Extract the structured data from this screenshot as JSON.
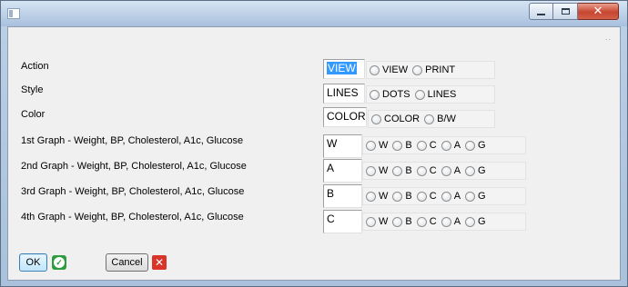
{
  "window": {
    "controls": {
      "minimize": "minimize",
      "maximize": "maximize",
      "close": "close"
    }
  },
  "rows": [
    {
      "label": "Action",
      "value": "VIEW",
      "options": [
        "VIEW",
        "PRINT"
      ]
    },
    {
      "label": "Style",
      "value": "LINES",
      "options": [
        "DOTS",
        "LINES"
      ]
    },
    {
      "label": "Color",
      "value": "COLOR",
      "options": [
        "COLOR",
        "B/W"
      ]
    },
    {
      "label": "1st Graph - Weight, BP, Cholesterol, A1c, Glucose",
      "value": "W",
      "options": [
        "W",
        "B",
        "C",
        "A",
        "G"
      ]
    },
    {
      "label": "2nd Graph - Weight, BP, Cholesterol, A1c, Glucose",
      "value": "A",
      "options": [
        "W",
        "B",
        "C",
        "A",
        "G"
      ]
    },
    {
      "label": "3rd Graph - Weight, BP, Cholesterol, A1c, Glucose",
      "value": "B",
      "options": [
        "W",
        "B",
        "C",
        "A",
        "G"
      ]
    },
    {
      "label": "4th Graph - Weight, BP, Cholesterol, A1c, Glucose",
      "value": "C",
      "options": [
        "W",
        "B",
        "C",
        "A",
        "G"
      ]
    }
  ],
  "buttons": {
    "ok": "OK",
    "cancel": "Cancel"
  },
  "colors": {
    "selection": "#3399ff",
    "ok_icon": "#2e9b3f",
    "cancel_icon": "#d8342a"
  }
}
